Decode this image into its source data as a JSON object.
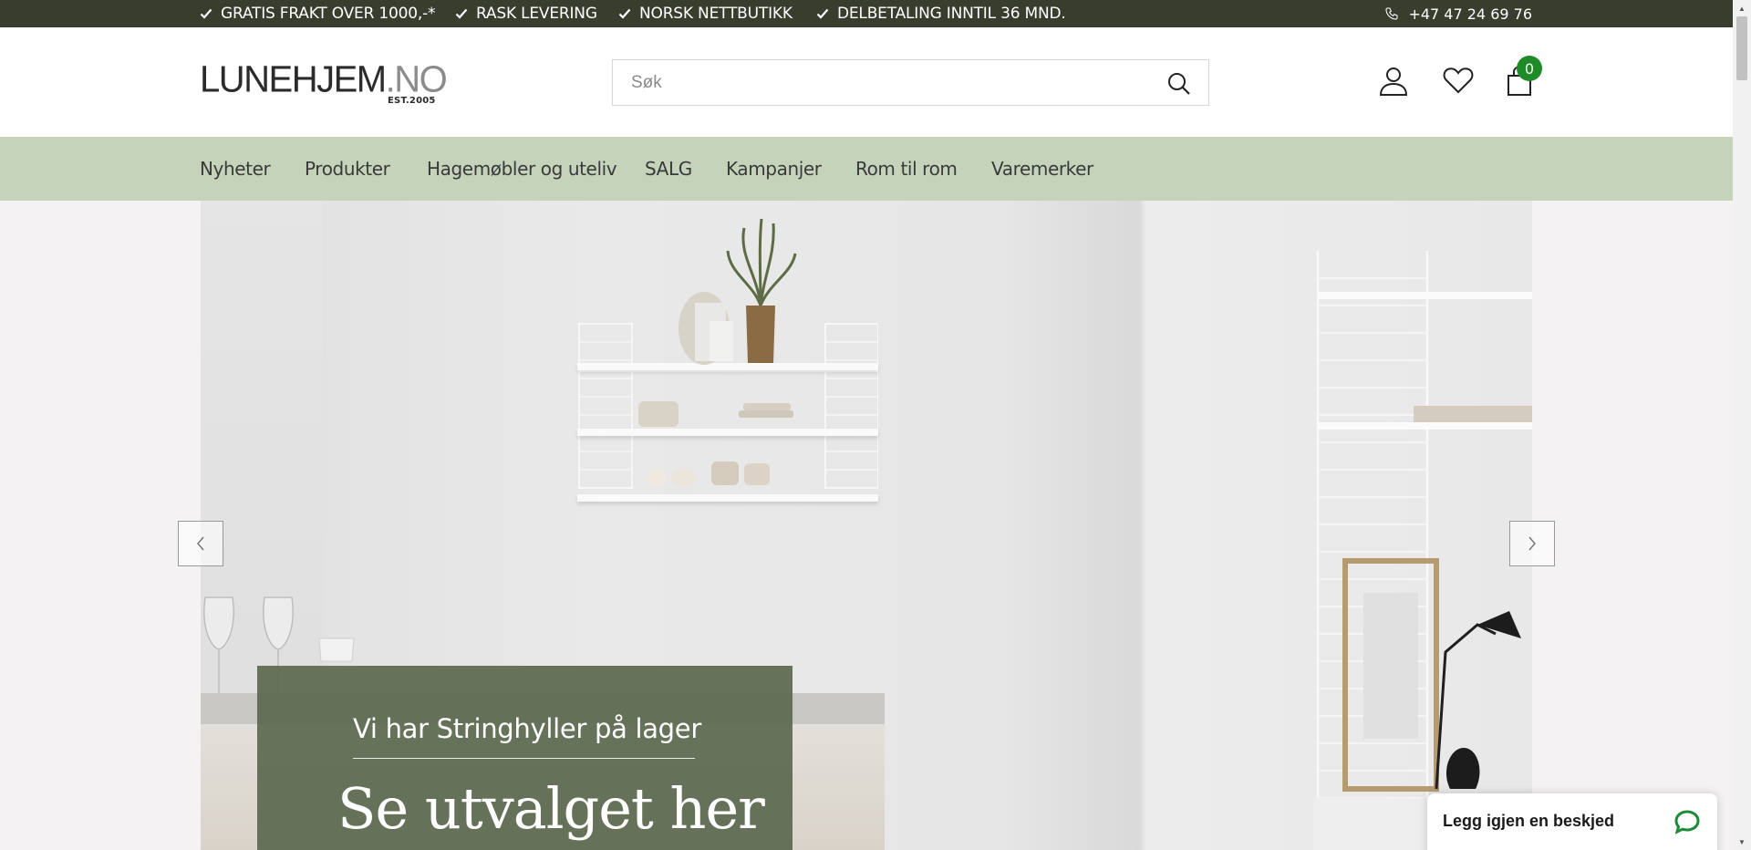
{
  "topbar": {
    "usps": [
      {
        "label": "GRATIS FRAKT OVER 1000,-*",
        "icon": "check-icon"
      },
      {
        "label": "RASK LEVERING",
        "icon": "check-icon"
      },
      {
        "label": "NORSK NETTBUTIKK",
        "icon": "check-icon"
      },
      {
        "label": "DELBETALING INNTIL 36 MND.",
        "icon": "check-icon"
      }
    ],
    "phone": "+47 47 24 69 76",
    "background": "#383d2e"
  },
  "header": {
    "logo_main": "LUNEHJEM",
    "logo_tld": ".NO",
    "logo_est": "EST.2005",
    "search_placeholder": "Søk",
    "cart_count": "0",
    "badge_color": "#1e8b28"
  },
  "nav": {
    "items": [
      {
        "label": "Nyheter"
      },
      {
        "label": "Produkter"
      },
      {
        "label": "Hagemøbler og uteliv"
      },
      {
        "label": "SALG"
      },
      {
        "label": "Kampanjer"
      },
      {
        "label": "Rom til rom"
      },
      {
        "label": "Varemerker"
      }
    ],
    "background": "#c5d3bb"
  },
  "hero": {
    "subtitle": "Vi har Stringhyller på lager",
    "title": "Se utvalget her",
    "caption_color": "#5f6c52"
  },
  "chat": {
    "label": "Legg igjen en beskjed",
    "icon": "chat-bubble-icon"
  }
}
